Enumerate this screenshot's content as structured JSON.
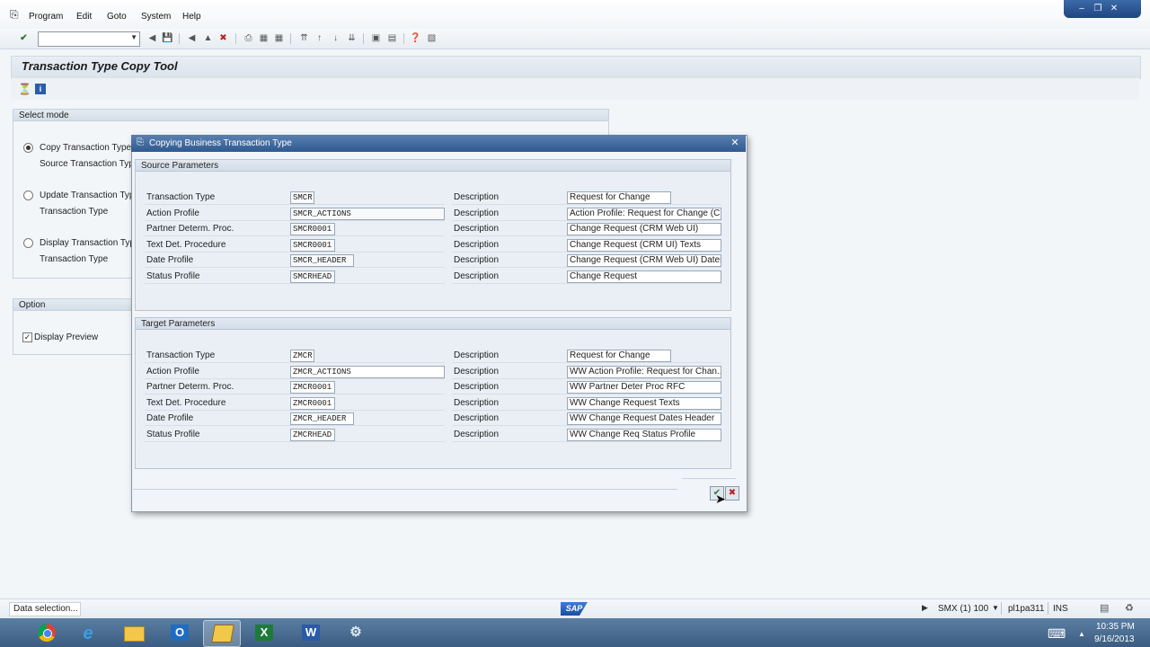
{
  "menu": {
    "items": [
      "Program",
      "Edit",
      "Goto",
      "System",
      "Help"
    ]
  },
  "page": {
    "title": "Transaction Type Copy Tool"
  },
  "select_mode": {
    "header": "Select mode",
    "copy_label": "Copy Transaction Type",
    "copy_sub_label": "Source Transaction Type",
    "update_label": "Update Transaction Type",
    "update_sub_label": "Transaction Type",
    "display_label": "Display Transaction Type",
    "display_sub_label": "Transaction Type"
  },
  "option": {
    "header": "Option",
    "display_preview_label": "Display Preview",
    "display_preview_checked": true
  },
  "dialog": {
    "title": "Copying Business Transaction Type",
    "source": {
      "header": "Source Parameters",
      "rows": [
        {
          "label": "Transaction Type",
          "value": "SMCR",
          "desc_label": "Description",
          "desc": "Request for Change"
        },
        {
          "label": "Action Profile",
          "value": "SMCR_ACTIONS",
          "desc_label": "Description",
          "desc": "Action Profile: Request for Change (C..."
        },
        {
          "label": "Partner Determ. Proc.",
          "value": "SMCR0001",
          "desc_label": "Description",
          "desc": "Change Request (CRM Web UI)"
        },
        {
          "label": "Text Det. Procedure",
          "value": "SMCR0001",
          "desc_label": "Description",
          "desc": "Change Request (CRM UI) Texts"
        },
        {
          "label": "Date Profile",
          "value": "SMCR_HEADER",
          "desc_label": "Description",
          "desc": "Change Request (CRM Web UI) Dates..."
        },
        {
          "label": "Status Profile",
          "value": "SMCRHEAD",
          "desc_label": "Description",
          "desc": "Change Request"
        }
      ]
    },
    "target": {
      "header": "Target Parameters",
      "rows": [
        {
          "label": "Transaction Type",
          "value": "ZMCR",
          "desc_label": "Description",
          "desc": "Request for Change"
        },
        {
          "label": "Action Profile",
          "value": "ZMCR_ACTIONS",
          "desc_label": "Description",
          "desc": "WW Action Profile: Request for Chan..."
        },
        {
          "label": "Partner Determ. Proc.",
          "value": "ZMCR0001",
          "desc_label": "Description",
          "desc": "WW Partner Deter Proc RFC"
        },
        {
          "label": "Text Det. Procedure",
          "value": "ZMCR0001",
          "desc_label": "Description",
          "desc": "WW Change Request Texts"
        },
        {
          "label": "Date Profile",
          "value": "ZMCR_HEADER",
          "desc_label": "Description",
          "desc": "WW Change Request Dates Header"
        },
        {
          "label": "Status Profile",
          "value": "ZMCRHEAD",
          "desc_label": "Description",
          "desc": "WW Change Req Status Profile"
        }
      ]
    }
  },
  "status": {
    "message": "Data selection...",
    "logo": "SAP",
    "system": "SMX (1) 100",
    "server": "pl1pa311",
    "mode": "INS"
  },
  "taskbar": {
    "time": "10:35 PM",
    "date": "9/16/2013",
    "apps": [
      "chrome-icon",
      "ie-icon",
      "explorer-icon",
      "outlook-icon",
      "sap-logon-icon",
      "excel-icon",
      "word-icon",
      "tool-icon"
    ]
  }
}
